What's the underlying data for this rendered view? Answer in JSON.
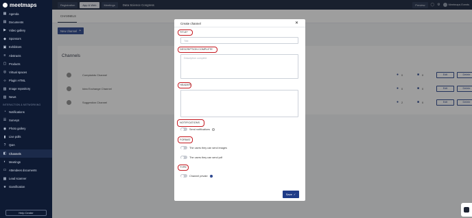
{
  "app": {
    "logo_text": "meetmaps"
  },
  "sidebar": {
    "items": [
      {
        "label": "Agenda",
        "icon": "calendar-icon"
      },
      {
        "label": "Documents",
        "icon": "document-icon"
      },
      {
        "label": "Video gallery",
        "icon": "video-icon"
      },
      {
        "label": "Sponsors",
        "icon": "handshake-icon"
      },
      {
        "label": "Exhibitors",
        "icon": "store-icon"
      },
      {
        "label": "Abstracts",
        "icon": "abstract-icon"
      },
      {
        "label": "Products",
        "icon": "box-icon"
      },
      {
        "label": "Virtual spaces",
        "icon": "space-icon"
      },
      {
        "label": "Plugin HTML",
        "icon": "code-icon"
      },
      {
        "label": "Image repository",
        "icon": "image-icon"
      },
      {
        "label": "News",
        "icon": "news-icon"
      }
    ],
    "section_label": "INTERACTION & NETWORKING",
    "items2": [
      {
        "label": "Notifications",
        "icon": "bell-icon"
      },
      {
        "label": "Surveys",
        "icon": "survey-icon"
      },
      {
        "label": "Photo gallery",
        "icon": "camera-icon"
      },
      {
        "label": "Live polls",
        "icon": "poll-icon"
      },
      {
        "label": "Q&A",
        "icon": "qa-icon"
      },
      {
        "label": "Channels",
        "icon": "chat-icon",
        "active": true
      },
      {
        "label": "Meetings",
        "icon": "meeting-icon"
      },
      {
        "label": "Attendees documents",
        "icon": "folder-icon"
      },
      {
        "label": "Lead scanner",
        "icon": "scanner-icon"
      },
      {
        "label": "Gamification",
        "icon": "trophy-icon"
      }
    ],
    "help_label": "Help Center"
  },
  "topbar": {
    "buttons": [
      "Registration",
      "App & Web",
      "Meetings"
    ],
    "active_button": "App & Web",
    "event_name": "Data Science Congress",
    "preview_label": "Preview",
    "user_name": "Meetmaps Events"
  },
  "main": {
    "tab_label": "CHANNELS",
    "new_button_label": "New channel",
    "card_title": "Channels",
    "rows": [
      {
        "name": "Complaints Channel",
        "members": "0",
        "messages": "0"
      },
      {
        "name": "Idea Exchange Channel",
        "members": "0",
        "messages": "0"
      },
      {
        "name": "Suggestion Channel",
        "members": "2",
        "messages": "0"
      }
    ],
    "edit_label": "Edit",
    "delete_label": "Delete"
  },
  "modal": {
    "title": "Create channel",
    "title_field_label": "TITLE*",
    "title_placeholder": "Title",
    "description_label": "DESCRIPTION COMPLETE",
    "description_placeholder": "Description complete",
    "header_label": "HEADER",
    "notifications_label": "NOTIFICATIONS",
    "send_notifications_label": "Send notifications",
    "format_label": "FORMAT",
    "format_options": [
      "The users they can send images",
      "The users they can send pdf"
    ],
    "type_label": "TYPE",
    "channel_private_label": "Channel private",
    "save_label": "Save",
    "highlight_color": "#c4151c"
  },
  "colors": {
    "sidebar_bg": "#0e1a33",
    "accent": "#1f3c88"
  }
}
